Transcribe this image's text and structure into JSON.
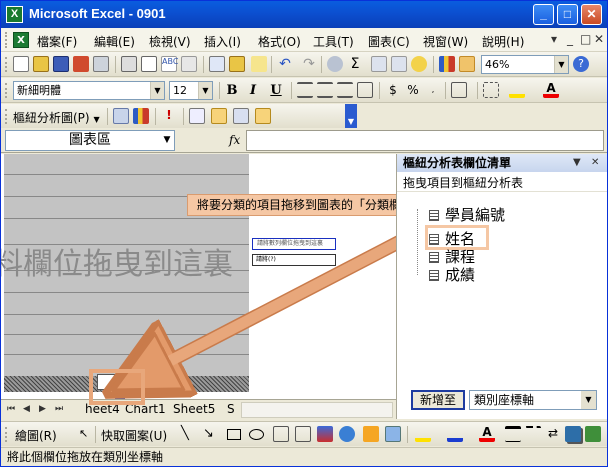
{
  "window": {
    "title": "Microsoft Excel - 0901",
    "app_icon_glyph": "X"
  },
  "caption_buttons": {
    "minimize": "_",
    "maximize": "□",
    "close": "✕"
  },
  "menu": {
    "items": [
      "檔案(F)",
      "編輯(E)",
      "檢視(V)",
      "插入(I)",
      "格式(O)",
      "工具(T)",
      "圖表(C)",
      "視窗(W)",
      "說明(H)"
    ],
    "right_controls": [
      "▾",
      "_",
      "□",
      "✕"
    ]
  },
  "standard_toolbar": {
    "zoom": "46%"
  },
  "format_toolbar": {
    "font": "新細明體",
    "size": "12",
    "bold": "B",
    "italic": "I",
    "underline": "U"
  },
  "pivot_toolbar": {
    "label": "樞紐分析圖(P)"
  },
  "formula_bar": {
    "name_box": "圖表區",
    "fx": "fx",
    "content": ""
  },
  "sheet": {
    "background_text": "料欄位拖曳到這裏",
    "legend1_text": "請將數列欄位拖曳到這裏",
    "legend2_text": "請將(?)"
  },
  "tabs": {
    "nav": [
      "⏮",
      "◀",
      "▶",
      "⏭"
    ],
    "items": [
      "heet4",
      "Chart1",
      "Sheet5",
      "S"
    ]
  },
  "callout": "將要分類的項目拖移到圖表的「分類欄位」區",
  "pane": {
    "title": "樞紐分析表欄位清單",
    "subtitle": "拖曳項目到樞紐分析表",
    "fields": [
      "學員編號",
      "姓名",
      "課程",
      "成績"
    ],
    "add_button": "新增至",
    "target_area": "類別座標軸"
  },
  "draw_toolbar": {
    "draw": "繪圖(R)",
    "autoshapes": "快取圖案(U)"
  },
  "status_bar": "將此個欄位拖放在類別坐標軸",
  "colors": {
    "titlebar": "#0a5ddf",
    "callout": "#f5c7a4",
    "arrow": "#e39a6a",
    "pane_title": "#c7d5ee"
  }
}
